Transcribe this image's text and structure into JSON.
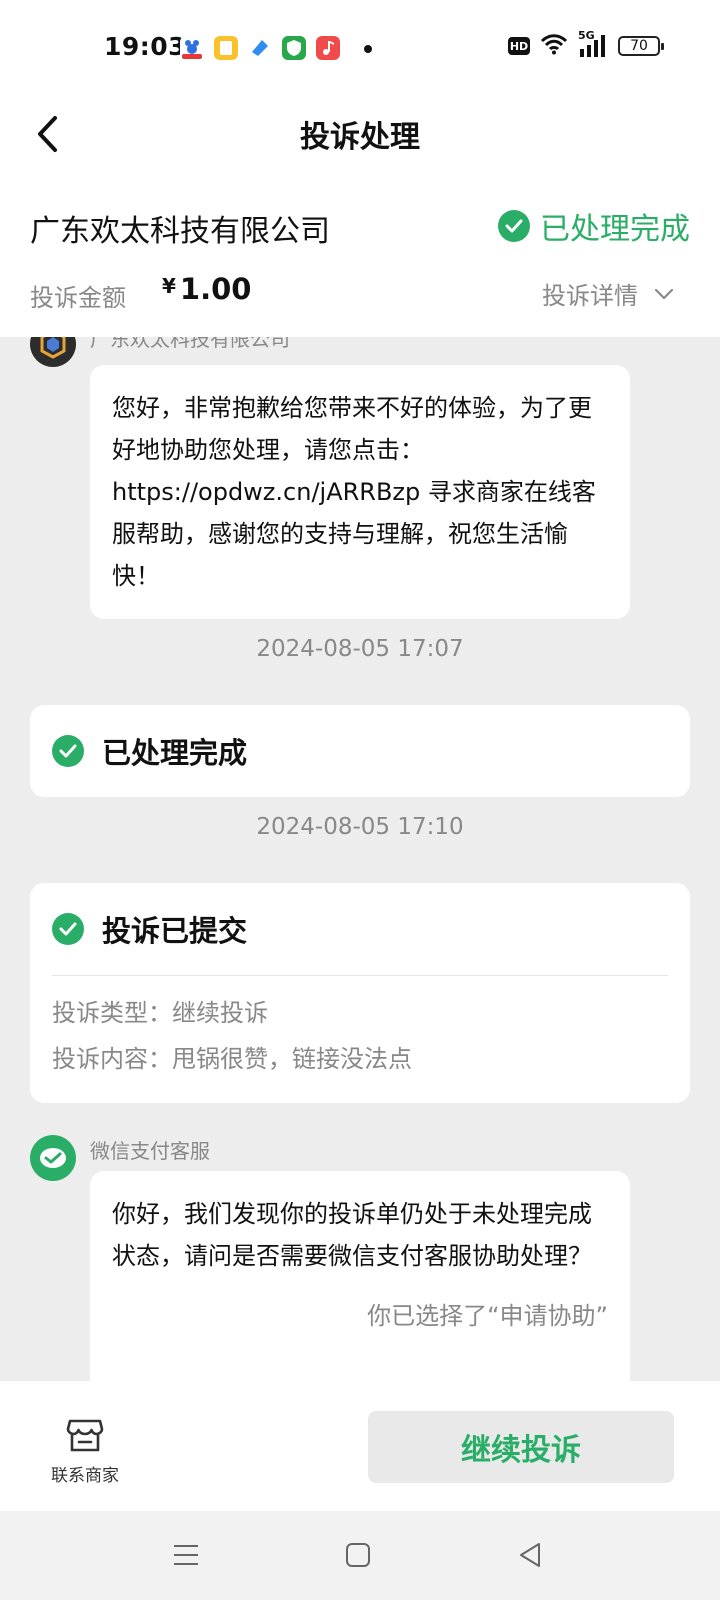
{
  "status_bar": {
    "time": "19:03",
    "hd": "HD",
    "network": "5G",
    "battery": "70",
    "app_icons": [
      "baidu-icon",
      "notes-icon",
      "browser-icon",
      "security-icon",
      "music-icon"
    ]
  },
  "nav": {
    "title": "投诉处理"
  },
  "merchant": {
    "name": "广东欢太科技有限公司",
    "status": "已处理完成",
    "amount_label": "投诉金额",
    "amount_currency": "¥",
    "amount_value": "1.00",
    "details_label": "投诉详情"
  },
  "messages": [
    {
      "sender": "广东欢太科技有限公司",
      "text": "您好，非常抱歉给您带来不好的体验，为了更好地协助您处理，请您点击：https://opdwz.cn/jARRBzp 寻求商家在线客服帮助，感谢您的支持与理解，祝您生活愉快！"
    }
  ],
  "timeline": [
    {
      "timestamp": "2024-08-05 17:07",
      "title": "已处理完成"
    },
    {
      "timestamp": "2024-08-05 17:10",
      "title": "投诉已提交",
      "type_label": "投诉类型：",
      "type_value": "继续投诉",
      "content_label": "投诉内容：",
      "content_value": "甩锅很赞，链接没法点"
    }
  ],
  "support": {
    "sender": "微信支付客服",
    "text": "你好，我们发现你的投诉单仍处于未处理完成状态，请问是否需要微信支付客服协助处理？",
    "reply_note": "你已选择了“申请协助”"
  },
  "bottom": {
    "contact_label": "联系商家",
    "continue_label": "继续投诉"
  },
  "colors": {
    "accent": "#2aae67",
    "background": "#ededed"
  }
}
